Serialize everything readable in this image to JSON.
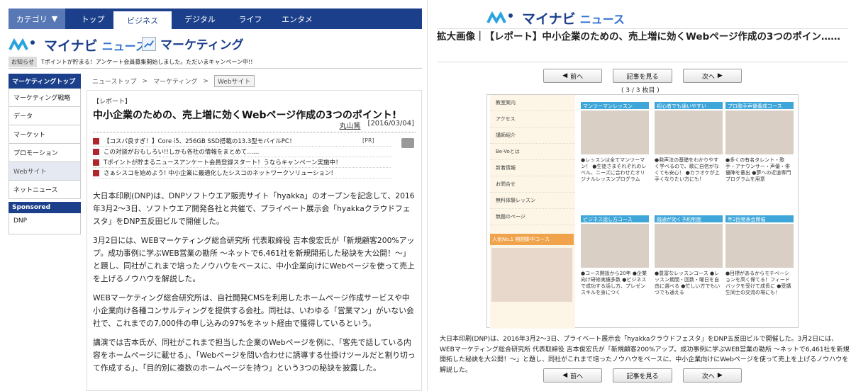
{
  "nav": {
    "category": "カテゴリ",
    "tabs": [
      "トップ",
      "ビジネス",
      "デジタル",
      "ライフ",
      "エンタメ"
    ],
    "active": "ビジネス"
  },
  "logo": {
    "brand": "マイナビ",
    "sub": "ニュース",
    "section": "マーケティング"
  },
  "notice": {
    "tag": "お知らせ",
    "text": "Tポイントが貯まる！アンケート会員募集開始しました。ただいまキャンペーン中!!"
  },
  "sidebar": {
    "head": "マーケティングトップ",
    "items": [
      "マーケティング戦略",
      "データ",
      "マーケット",
      "プロモーション",
      "Webサイト",
      "ネットニュース"
    ],
    "selected": "Webサイト",
    "sponsored": "Sponsored",
    "sponsor_item": "DNP"
  },
  "breadcrumb": [
    "ニューストップ",
    "マーケティング",
    "Webサイト"
  ],
  "article": {
    "kicker": "【レポート】",
    "title": "中小企業のための、売上増に効くWebページ作成の3つのポイント!",
    "author": "丸山篤",
    "date": "[2016/03/04]",
    "ads": [
      "【コスパ良すぎ！】Core i5、256GB SSD搭載の13.3型モバイルPC！",
      "この対談がおもしろい!!しかも各社の情報をまとめて……",
      "Tポイントが貯まるニュースアンケート会員登録スタート！うならキャンペーン実施中！",
      "さぁシスコを始めよう! 中小企業に最適化したシスコのネットワークソリューション!"
    ],
    "pr": "[PR]",
    "paragraphs": [
      "大日本印刷(DNP)は、DNPソフトウエア販売サイト「hyakka」のオープンを記念して、2016年3月2～3日、ソフトウエア開発各社と共催で、プライベート展示会「hyakkaクラウドフェスタ」をDNP五反田ビルで開催した。",
      "3月2日には、WEBマーケティング総合研究所 代表取締役 吉本俊宏氏が「新規顧客200%アップ。成功事例に学ぶWEB営業の勘所 ～ネットで6,461社を新規開拓した秘訣を大公開！～」と題し、同社がこれまで培ったノウハウをベースに、中小企業向けにWebページを使って売上を上げるノウハウを解説した。",
      "WEBマーケティング総合研究所は、自社開発CMSを利用したホームページ作成サービスや中小企業向け各種コンサルティングを提供する会社。同社は、いわゆる「営業マン」がいない会社で、これまでの7,000件の申し込みの97%をネット経由で獲得しているという。",
      "講演では吉本氏が、同社がこれまで担当した企業のWebページを例に、「客先で話している内容をホームページに載せる」、「Webページを問い合わせに誘導する仕掛けツールだと割り切って作成する」、「目的別に複数のホームページを持つ」という3つの秘訣を披露した。"
    ]
  },
  "viewer": {
    "title": "拡大画像｜【レポート】中小企業のための、売上増に効くWebページ作成の3つのポイン……",
    "prev": "前へ",
    "view": "記事を見る",
    "next": "次へ",
    "pager": "( 3 / 3 枚目 )",
    "side_links": [
      "教室案内",
      "アクセス",
      "講師紹介",
      "Be-Voとは",
      "新着情報",
      "お問合せ",
      "無料体験レッスン",
      "無題のページ"
    ],
    "banner": "人気No.1 期間集中コース",
    "cells": [
      {
        "head": "マンツーマンレッスン",
        "text": "●レッスンは全てマンツーマン！ ●生徒さまそれぞれのレベル、ニーズに合わせたオリジナルレッスンプログラム"
      },
      {
        "head": "初心者でも通いやすい",
        "text": "●発声法の基礎をわかりやすく学べるので、歌に自信がなくても安心！ ●カラオケが上手くなりたい方にも！"
      },
      {
        "head": "プロ歌手声優養成コース",
        "text": "●多くの有名タレント・歌手・アナウンサー・声優・俳優陣を輩出 ●夢への近道専門プログラムを用意"
      },
      {
        "head": "ビジネス話し方コース",
        "text": "●コース開設から20年 ●企業向け研修実績多数 ●ビジネスで成功する話し方、プレゼンスキルを身につく"
      },
      {
        "head": "融通が効く予約制度",
        "text": "●豊富なレッスンコース ●レッスン期間・回数・曜日を自由に選べる ●忙しい方でもいつでも通える"
      },
      {
        "head": "年2回発表会開催",
        "text": "●目標があるからモチベーションを高く保てる！フィードバックを受けて成長に ●受講生同士の交流の場にも！"
      }
    ],
    "caption": "大日本印刷(DNP)は、2016年3月2～3日、プライベート展示会「hyakkaクラウドフェスタ」をDNP五反田ビルで開催した。3月2日には、WEBマーケティング総合研究所 代表取締役 吉本俊宏氏が「新規顧客200%アップ。成功事例に学ぶWEB営業の勘所 ～ネットで6,461社を新規開拓した秘訣を大公開！～」と題し、同社がこれまで培ったノウハウをベースに、中小企業向けにWebページを使って売上を上げるノウハウを解説した。"
  }
}
